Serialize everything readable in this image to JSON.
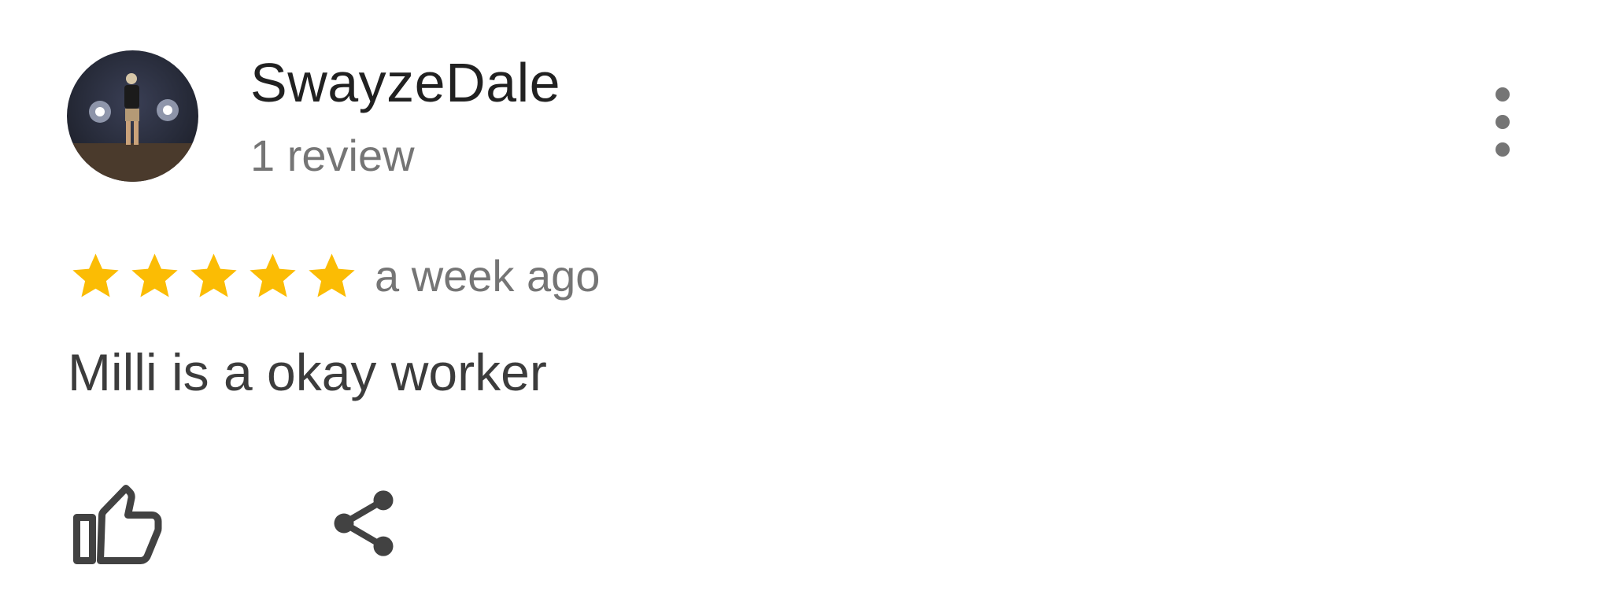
{
  "review": {
    "author_name": "SwayzeDale",
    "review_count": "1 review",
    "rating": 5,
    "rating_max": 5,
    "timestamp": "a week ago",
    "text": "Milli is a okay worker"
  },
  "icons": {
    "avatar": "avatar-photo",
    "menu": "more-vert-icon",
    "star": "star-icon",
    "like": "thumb-up-icon",
    "share": "share-icon"
  },
  "colors": {
    "star": "#FBBC04",
    "name_text": "#212121",
    "secondary_text": "#757575",
    "body_text": "#3C3C3C",
    "icon": "#424242"
  }
}
